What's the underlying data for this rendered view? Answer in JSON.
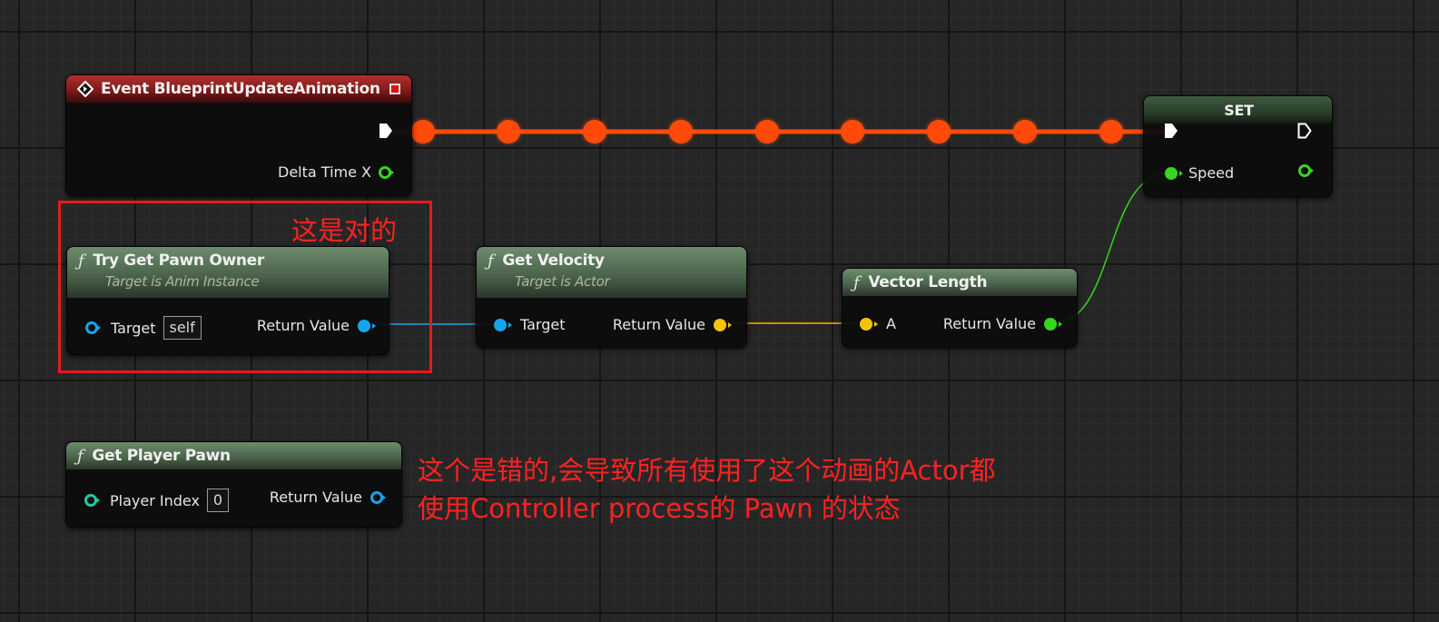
{
  "colors": {
    "exec_wire": "#ff4a0a",
    "object_pin": "#14a5f0",
    "vector_pin": "#f5c400",
    "float_pin": "#35d61d",
    "annotation_red": "#e8191b"
  },
  "event_node": {
    "title": "Event BlueprintUpdateAnimation",
    "icon": "event-diamond-icon",
    "pins": {
      "delta_time": "Delta Time X"
    }
  },
  "set_node": {
    "title": "SET",
    "pins": {
      "speed": "Speed"
    }
  },
  "try_get_pawn_owner": {
    "title": "Try Get Pawn Owner",
    "subtitle": "Target is Anim Instance",
    "pins": {
      "target": "Target",
      "target_value": "self",
      "return": "Return Value"
    }
  },
  "get_velocity": {
    "title": "Get Velocity",
    "subtitle": "Target is Actor",
    "pins": {
      "target": "Target",
      "return": "Return Value"
    }
  },
  "vector_length": {
    "title": "Vector Length",
    "pins": {
      "a": "A",
      "return": "Return Value"
    }
  },
  "get_player_pawn": {
    "title": "Get Player Pawn",
    "pins": {
      "player_index": "Player Index",
      "player_index_value": "0",
      "return": "Return Value"
    }
  },
  "function_glyph": "ƒ",
  "annotations": {
    "correct": "这是对的",
    "wrong_line1": "这个是错的,会导致所有使用了这个动画的Actor都",
    "wrong_line2": "使用Controller process的 Pawn 的状态"
  }
}
